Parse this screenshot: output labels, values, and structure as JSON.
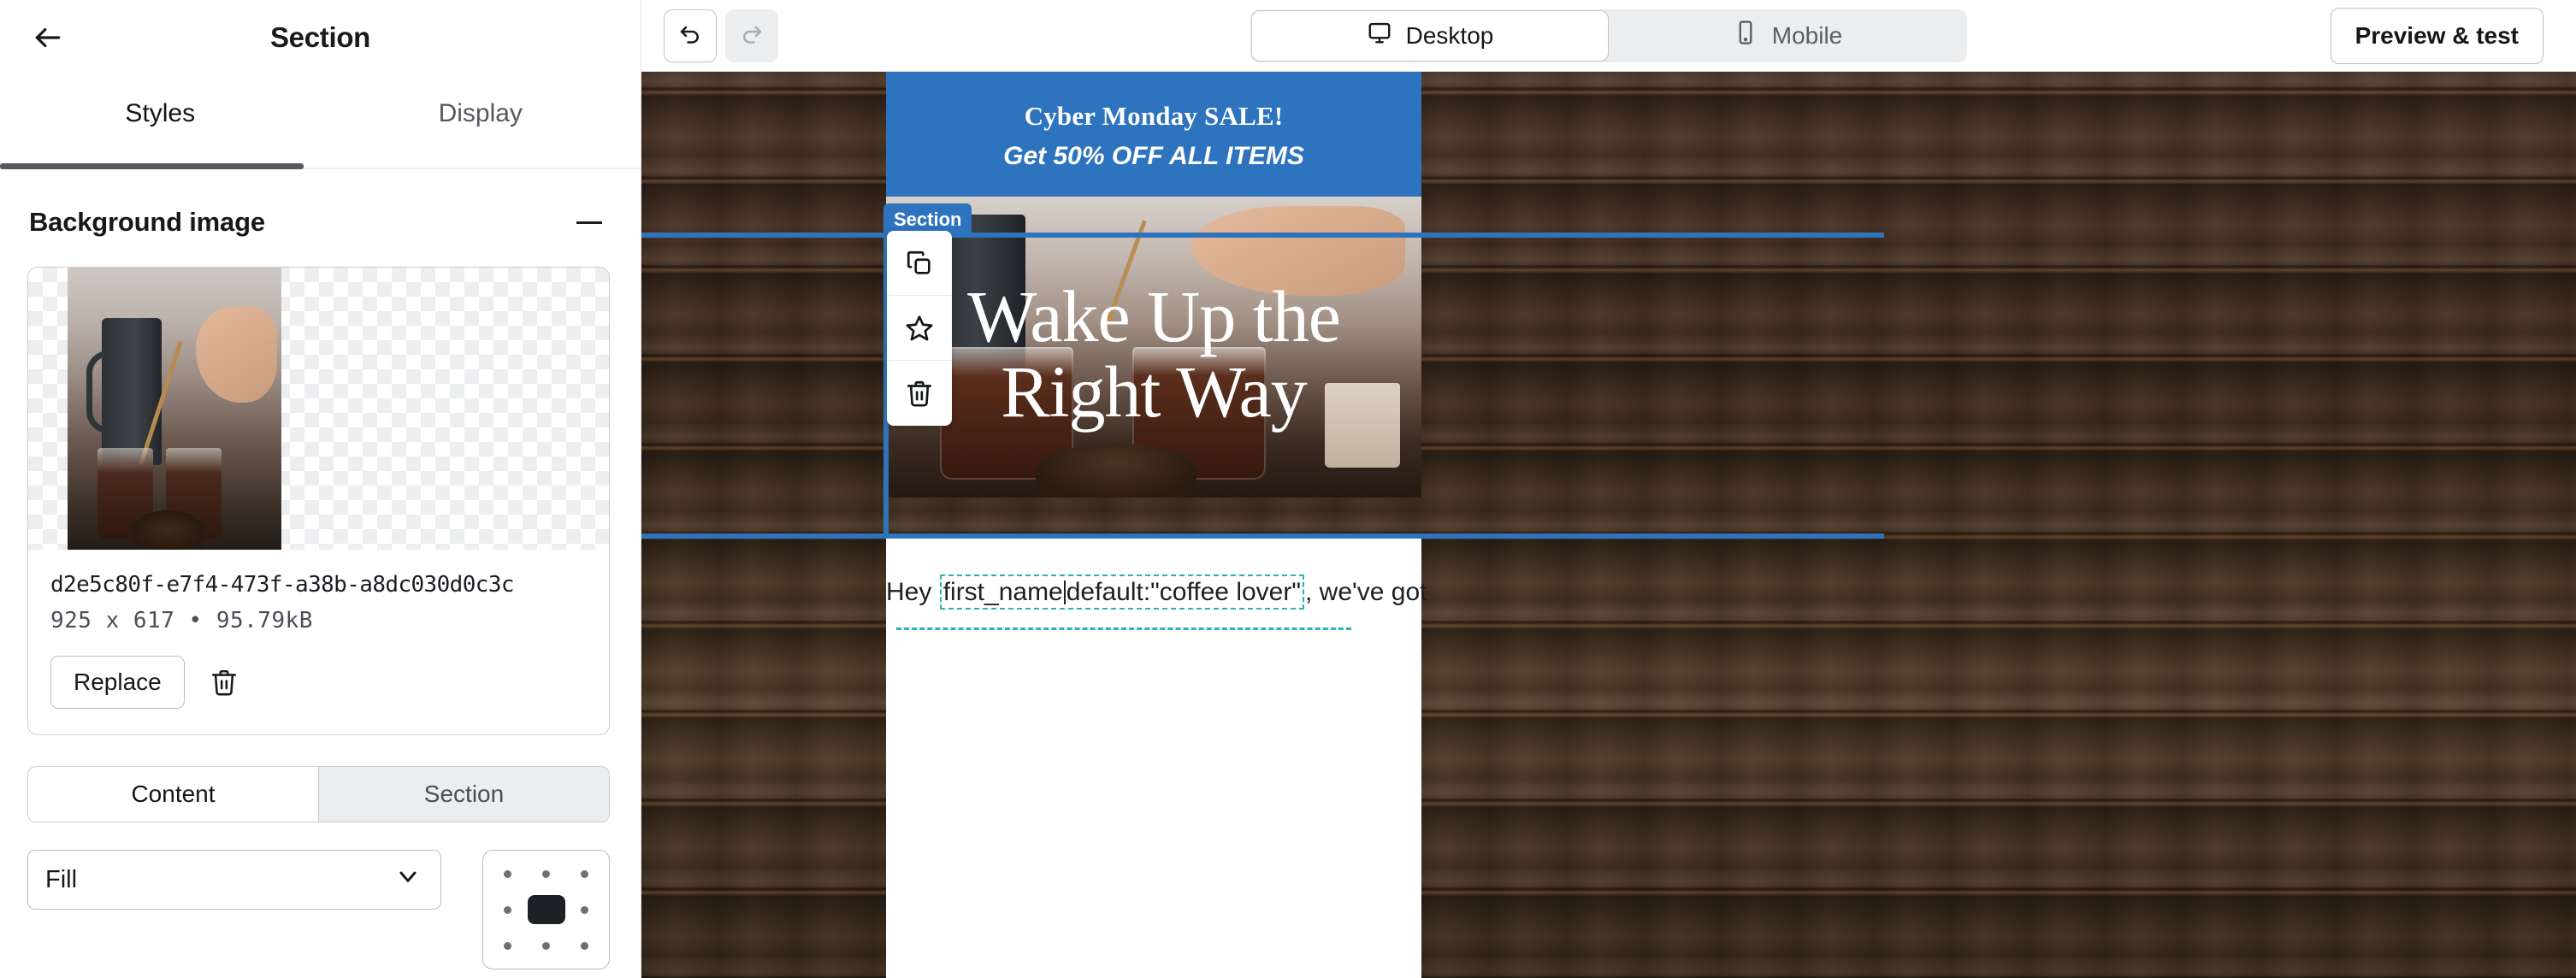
{
  "sidebar": {
    "back_icon": "arrow-left-icon",
    "title": "Section",
    "tabs": [
      {
        "label": "Styles",
        "active": true
      },
      {
        "label": "Display",
        "active": false
      }
    ],
    "background_section": {
      "title": "Background image",
      "collapse_icon": "minus-icon",
      "image": {
        "filename": "d2e5c80f-e7f4-473f-a38b-a8dc030d0c3c",
        "dimensions": "925 x 617 • 95.79kB",
        "replace_label": "Replace",
        "delete_icon": "trash-icon"
      },
      "scope_tabs": [
        {
          "label": "Content",
          "active": true
        },
        {
          "label": "Section",
          "active": false
        }
      ],
      "size_select": {
        "value": "Fill",
        "chevron_icon": "chevron-down-icon"
      },
      "position_picker": {
        "name": "background-position-picker",
        "selected": "center"
      }
    }
  },
  "toolbar": {
    "undo_icon": "undo-icon",
    "redo_icon": "redo-icon",
    "devices": [
      {
        "label": "Desktop",
        "icon": "monitor-icon",
        "active": true
      },
      {
        "label": "Mobile",
        "icon": "phone-icon",
        "active": false
      }
    ],
    "preview_label": "Preview & test"
  },
  "canvas": {
    "selection": {
      "badge": "Section",
      "accent_color": "#2e73bd",
      "tools": [
        {
          "name": "duplicate-icon"
        },
        {
          "name": "favorite-icon"
        },
        {
          "name": "delete-icon"
        }
      ]
    },
    "email": {
      "banner": {
        "line1": "Cyber Monday SALE!",
        "line2": "Get 50% OFF ALL ITEMS",
        "background_color": "#2e73bd"
      },
      "hero": {
        "title_line1": "Wake Up the",
        "title_line2": "Right Way"
      },
      "body": {
        "greeting_prefix": "Hey ",
        "merge_tag_before_caret": "first_name",
        "merge_tag_after_caret": "default:\"coffee lover\"",
        "greeting_suffix": ", we've got",
        "merge_tag_color": "#2bb3b3"
      }
    }
  }
}
